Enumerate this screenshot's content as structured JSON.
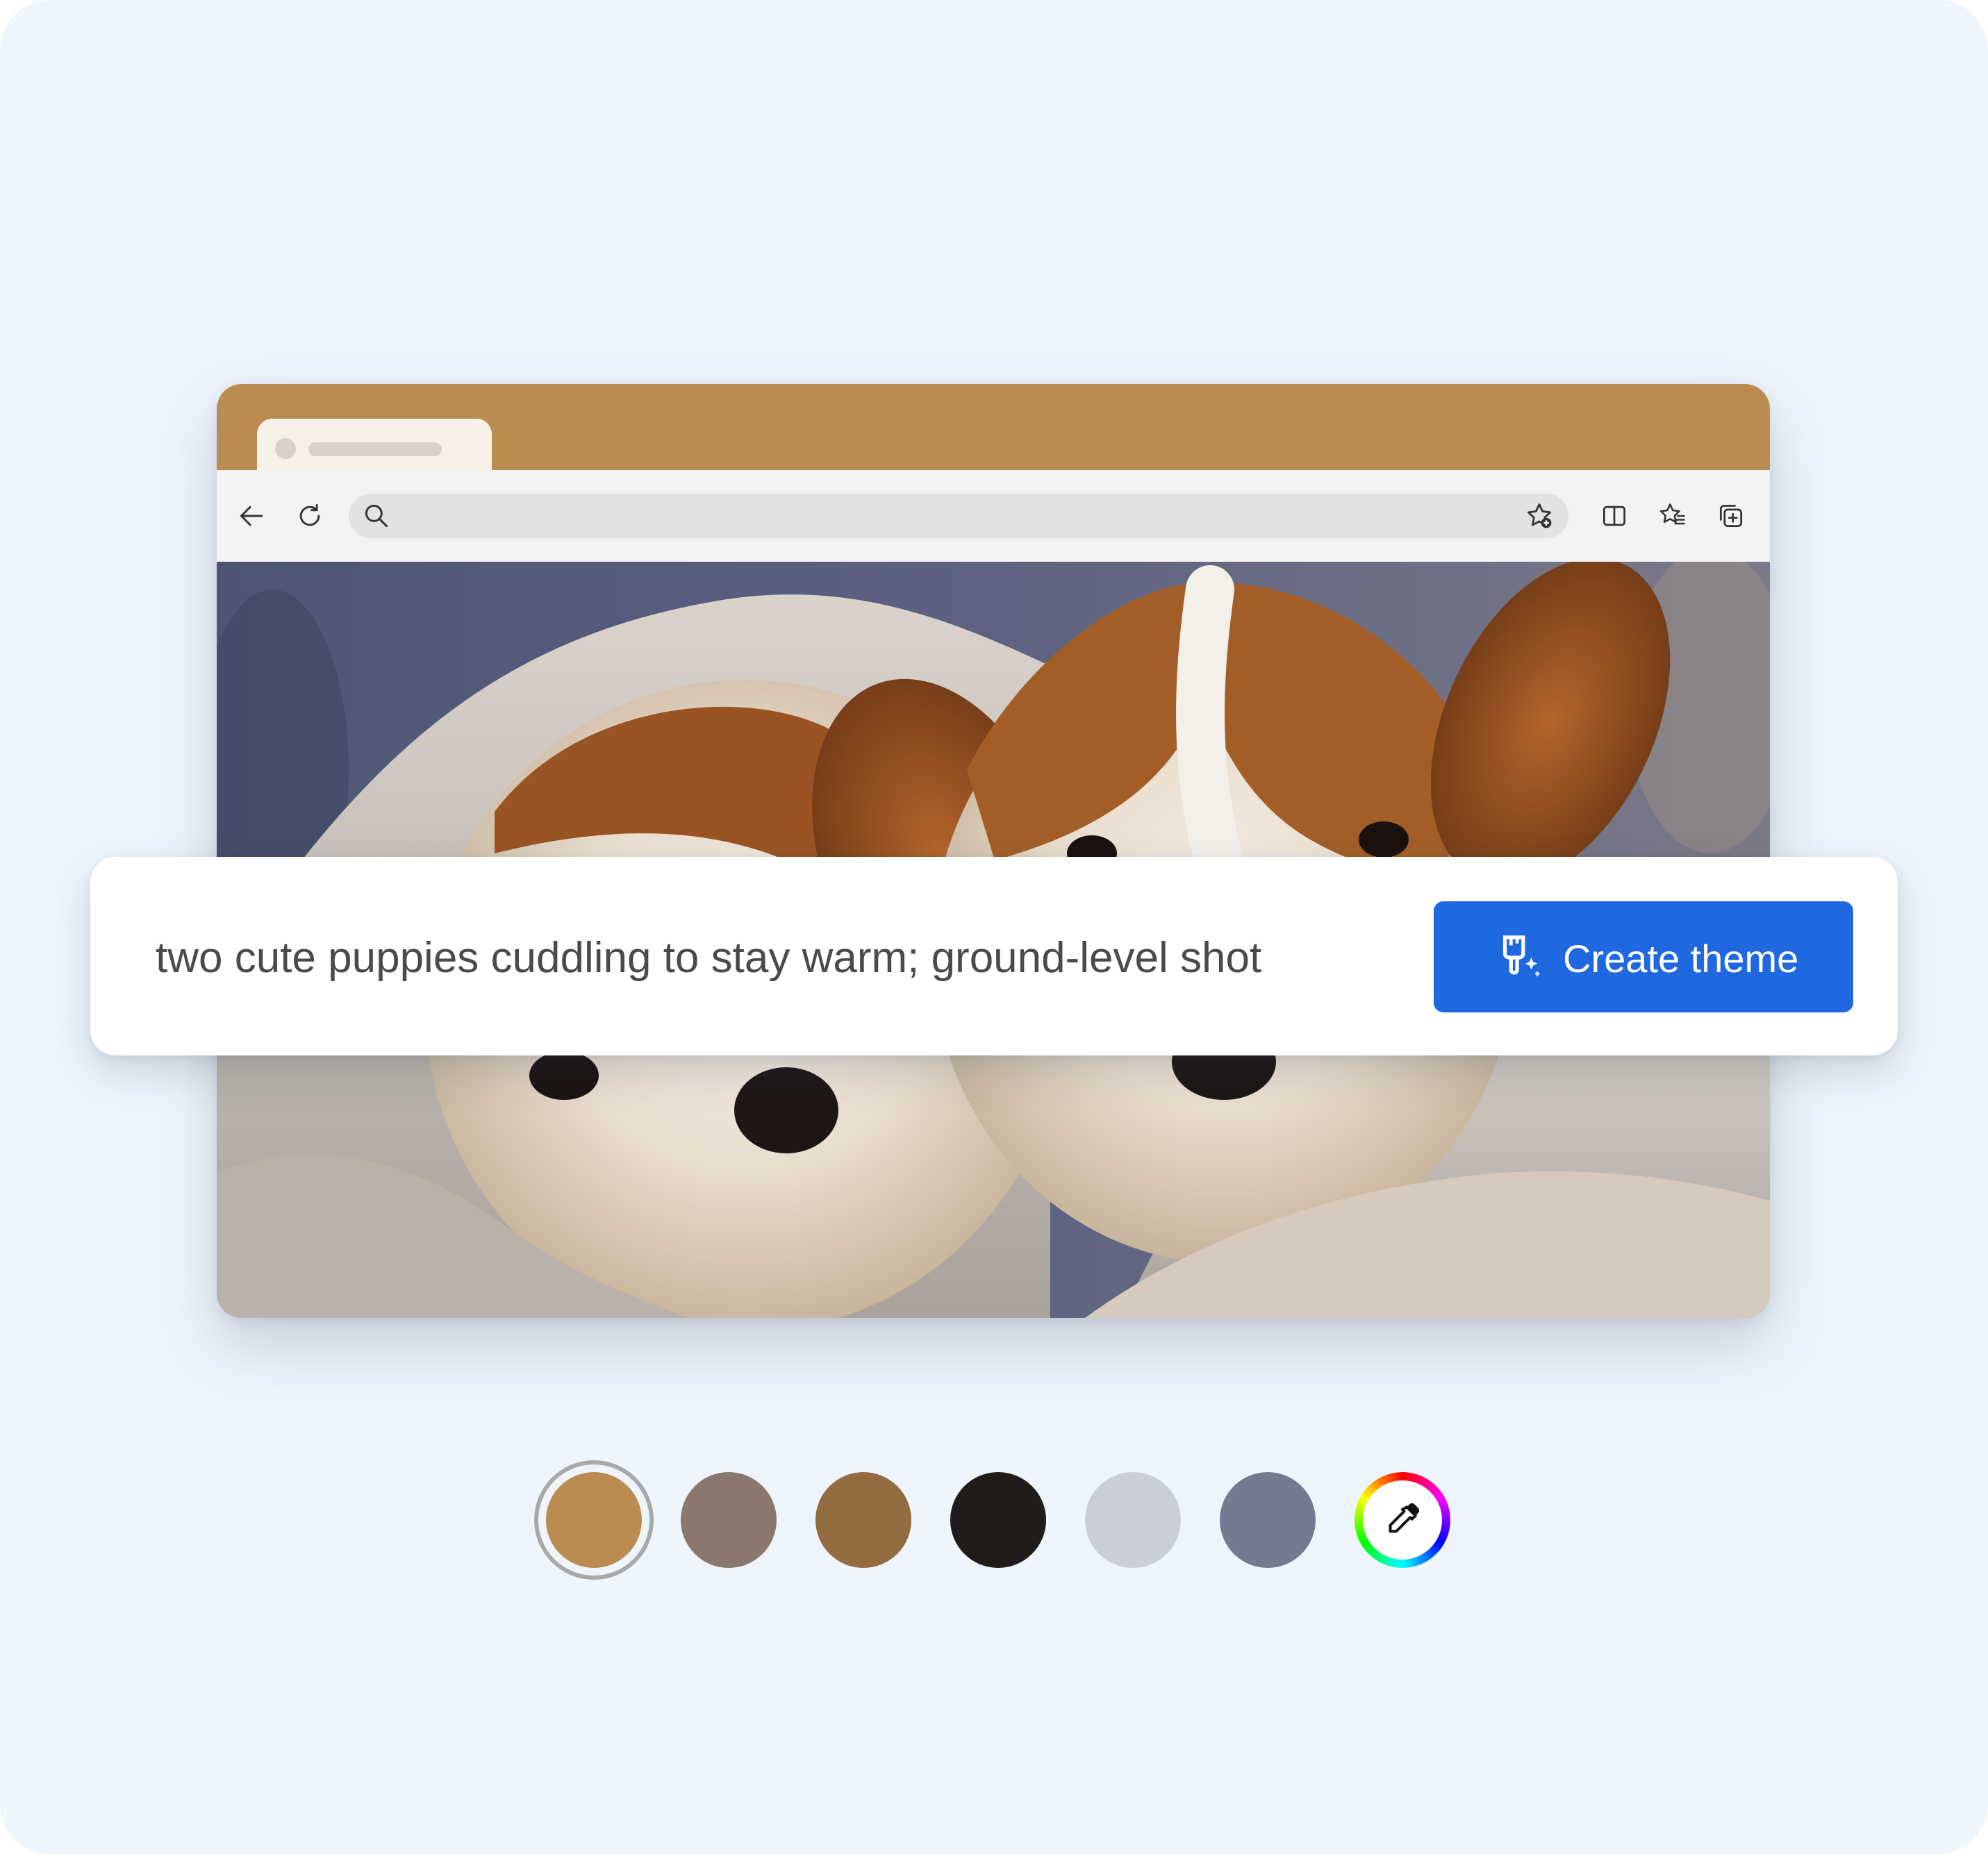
{
  "prompt": {
    "text": "two cute puppies cuddling to stay warm; ground-level shot",
    "create_button_label": "Create theme"
  },
  "browser": {
    "frame_color": "#bb8c50",
    "tab_color": "#f7f1e8",
    "toolbar_icons": [
      "back-arrow-icon",
      "refresh-icon",
      "search-icon",
      "favorite-add-icon",
      "split-screen-icon",
      "favorites-icon",
      "collections-icon"
    ]
  },
  "swatches": [
    {
      "name": "swatch-tan",
      "color": "#bb8c50",
      "selected": true
    },
    {
      "name": "swatch-taupe",
      "color": "#8a786d",
      "selected": false
    },
    {
      "name": "swatch-brown",
      "color": "#936b3f",
      "selected": false
    },
    {
      "name": "swatch-black",
      "color": "#1f1c1a",
      "selected": false
    },
    {
      "name": "swatch-light-gray",
      "color": "#c9ced9",
      "selected": false
    },
    {
      "name": "swatch-slate",
      "color": "#757a90",
      "selected": false
    }
  ],
  "picker": {
    "icon": "eyedropper-icon"
  },
  "accent_color": "#1f68e0"
}
